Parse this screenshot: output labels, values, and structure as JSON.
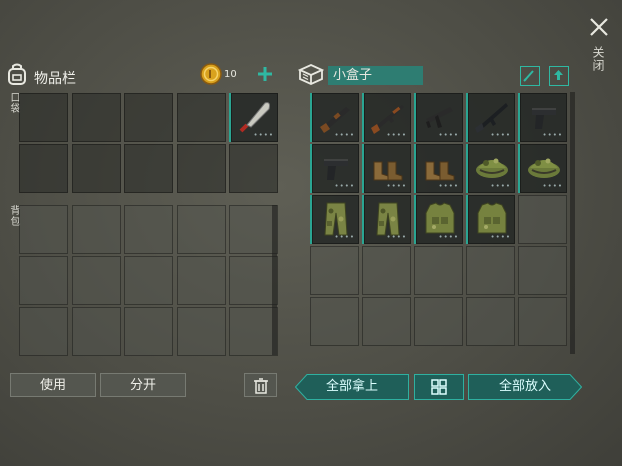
{
  "close": {
    "label": "关闭"
  },
  "inventory": {
    "title": "物品栏",
    "coin_count": "10",
    "pocket_label": "口袋",
    "backpack_label": "背包"
  },
  "container": {
    "title": "小盒子"
  },
  "buttons": {
    "use": "使用",
    "split": "分开",
    "take_all": "全部拿上",
    "put_all": "全部放入"
  },
  "pocket_items": [
    {
      "slot": 5,
      "item": "machete-icon"
    }
  ],
  "container_items": [
    "sawed-off-shotgun-icon",
    "ak-rifle-icon",
    "smg-icon",
    "assault-rifle-icon",
    "pistol-icon",
    "pistol-icon",
    "boots-icon",
    "boots-icon",
    "camo-cap-icon",
    "camo-cap-icon",
    "camo-pants-icon",
    "camo-pants-icon",
    "camo-vest-icon",
    "camo-vest-icon"
  ],
  "colors": {
    "accent": "#2aa592",
    "coin": "#d9a21e"
  }
}
